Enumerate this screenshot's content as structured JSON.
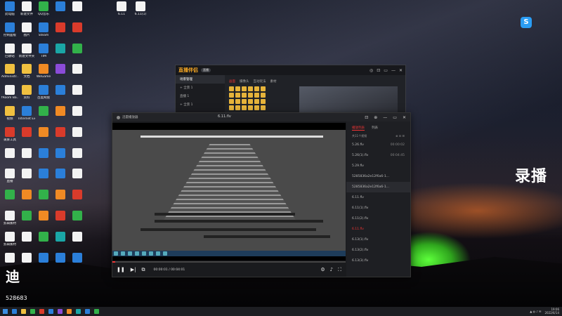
{
  "desktop": {
    "icons": [
      {
        "label": "此电脑",
        "col": 0,
        "row": 0,
        "kind": "app-blue"
      },
      {
        "label": "控制面板",
        "col": 0,
        "row": 1,
        "kind": "app-blue"
      },
      {
        "label": "回收站",
        "col": 0,
        "row": 2,
        "kind": "file"
      },
      {
        "label": "Administr...",
        "col": 0,
        "row": 3,
        "kind": "folder"
      },
      {
        "label": "fRoom Ba...",
        "col": 0,
        "row": 4,
        "kind": "file"
      },
      {
        "label": "视频",
        "col": 0,
        "row": 5,
        "kind": "folder"
      },
      {
        "label": "录屏工具",
        "col": 0,
        "row": 6,
        "kind": "app-red"
      },
      {
        "label": "",
        "col": 0,
        "row": 7,
        "kind": "file"
      },
      {
        "label": "直播",
        "col": 0,
        "row": 8,
        "kind": "file"
      },
      {
        "label": "",
        "col": 0,
        "row": 9,
        "kind": "app-green"
      },
      {
        "label": "剪辑素材",
        "col": 0,
        "row": 10,
        "kind": "file"
      },
      {
        "label": "剪辑素材",
        "col": 0,
        "row": 11,
        "kind": "file"
      },
      {
        "label": "",
        "col": 0,
        "row": 12,
        "kind": "file"
      },
      {
        "label": "新建文件",
        "col": 1,
        "row": 0,
        "kind": "file"
      },
      {
        "label": "图片",
        "col": 1,
        "row": 1,
        "kind": "file"
      },
      {
        "label": "新建文件夹",
        "col": 1,
        "row": 2,
        "kind": "file"
      },
      {
        "label": "文档",
        "col": 1,
        "row": 3,
        "kind": "folder"
      },
      {
        "label": "资料",
        "col": 1,
        "row": 4,
        "kind": "folder"
      },
      {
        "label": "Internet Explorer",
        "col": 1,
        "row": 5,
        "kind": "app-blue"
      },
      {
        "label": "",
        "col": 1,
        "row": 6,
        "kind": "app-red"
      },
      {
        "label": "",
        "col": 1,
        "row": 7,
        "kind": "file"
      },
      {
        "label": "",
        "col": 1,
        "row": 8,
        "kind": "file"
      },
      {
        "label": "",
        "col": 1,
        "row": 9,
        "kind": "app-orange"
      },
      {
        "label": "",
        "col": 1,
        "row": 10,
        "kind": "app-green"
      },
      {
        "label": "",
        "col": 1,
        "row": 11,
        "kind": "file"
      },
      {
        "label": "",
        "col": 1,
        "row": 12,
        "kind": "file"
      },
      {
        "label": "QQ音乐",
        "col": 2,
        "row": 0,
        "kind": "app-green"
      },
      {
        "label": "Steam",
        "col": 2,
        "row": 1,
        "kind": "app-blue"
      },
      {
        "label": "TIM",
        "col": 2,
        "row": 2,
        "kind": "app-blue"
      },
      {
        "label": "WeGame",
        "col": 2,
        "row": 3,
        "kind": "app-orange"
      },
      {
        "label": "百度网盘",
        "col": 2,
        "row": 4,
        "kind": "app-blue"
      },
      {
        "label": "",
        "col": 2,
        "row": 5,
        "kind": "app-green"
      },
      {
        "label": "",
        "col": 2,
        "row": 6,
        "kind": "app-orange"
      },
      {
        "label": "",
        "col": 2,
        "row": 7,
        "kind": "app-blue"
      },
      {
        "label": "",
        "col": 2,
        "row": 8,
        "kind": "app-blue"
      },
      {
        "label": "",
        "col": 2,
        "row": 9,
        "kind": "app-green"
      },
      {
        "label": "",
        "col": 2,
        "row": 10,
        "kind": "app-orange"
      },
      {
        "label": "",
        "col": 2,
        "row": 11,
        "kind": "app-green"
      },
      {
        "label": "",
        "col": 2,
        "row": 12,
        "kind": "app-blue"
      },
      {
        "label": "",
        "col": 3,
        "row": 0,
        "kind": "app-blue"
      },
      {
        "label": "",
        "col": 3,
        "row": 1,
        "kind": "app-red"
      },
      {
        "label": "",
        "col": 3,
        "row": 2,
        "kind": "app-teal"
      },
      {
        "label": "",
        "col": 3,
        "row": 3,
        "kind": "app-purple"
      },
      {
        "label": "",
        "col": 3,
        "row": 4,
        "kind": "app-blue"
      },
      {
        "label": "",
        "col": 3,
        "row": 5,
        "kind": "app-orange"
      },
      {
        "label": "",
        "col": 3,
        "row": 6,
        "kind": "app-red"
      },
      {
        "label": "",
        "col": 3,
        "row": 7,
        "kind": "app-blue"
      },
      {
        "label": "",
        "col": 3,
        "row": 8,
        "kind": "app-blue"
      },
      {
        "label": "",
        "col": 3,
        "row": 9,
        "kind": "app-orange"
      },
      {
        "label": "",
        "col": 3,
        "row": 10,
        "kind": "app-red"
      },
      {
        "label": "",
        "col": 3,
        "row": 11,
        "kind": "app-teal"
      },
      {
        "label": "",
        "col": 3,
        "row": 12,
        "kind": "app-blue"
      },
      {
        "label": "",
        "col": 4,
        "row": 0,
        "kind": "file"
      },
      {
        "label": "",
        "col": 4,
        "row": 1,
        "kind": "app-red"
      },
      {
        "label": "",
        "col": 4,
        "row": 2,
        "kind": "app-green"
      },
      {
        "label": "",
        "col": 4,
        "row": 3,
        "kind": "file"
      },
      {
        "label": "",
        "col": 4,
        "row": 4,
        "kind": "file"
      },
      {
        "label": "",
        "col": 4,
        "row": 5,
        "kind": "file"
      },
      {
        "label": "",
        "col": 4,
        "row": 6,
        "kind": "file"
      },
      {
        "label": "",
        "col": 4,
        "row": 7,
        "kind": "file"
      },
      {
        "label": "",
        "col": 4,
        "row": 8,
        "kind": "file"
      },
      {
        "label": "",
        "col": 4,
        "row": 9,
        "kind": "app-red"
      },
      {
        "label": "",
        "col": 4,
        "row": 10,
        "kind": "app-green"
      },
      {
        "label": "",
        "col": 4,
        "row": 11,
        "kind": "file"
      },
      {
        "label": "",
        "col": 4,
        "row": 12,
        "kind": "app-blue"
      },
      {
        "label": "6.11",
        "col": "x170",
        "row": 0,
        "kind": "file"
      },
      {
        "label": "6.11(1)",
        "col": "x197",
        "row": 0,
        "kind": "file"
      }
    ],
    "side_text": "录播",
    "corner_logo": "S",
    "cam_id_glyph": "迪",
    "cam_id_number": "528683"
  },
  "bg_window": {
    "brand": "直播伴侣",
    "badge": "直播",
    "controls": [
      "◎",
      "⊡",
      "▭",
      "—",
      "✕"
    ],
    "sidebar": [
      "场景管理",
      "+ 全景 1",
      "直播 1",
      "+ 全景 1"
    ],
    "tabs": [
      "画面",
      "摄像头",
      "互动玩法",
      "素材"
    ]
  },
  "player": {
    "logo": "迅雷播放器",
    "file_title": "6.11.flv",
    "title_controls": [
      "⊡",
      "⊕",
      "—",
      "▭",
      "✕"
    ],
    "time": "00:00:01 / 00:04:01",
    "progress": 0.01,
    "playlist": {
      "tabs": [
        "播放列表",
        "列表"
      ],
      "header": "共11个视频",
      "items": [
        {
          "name": "5.26.flv",
          "dur": "00:00:02"
        },
        {
          "name": "5.26(1).flv",
          "dur": "00:04:45"
        },
        {
          "name": "5.29.flv",
          "dur": ""
        },
        {
          "name": "5285836a2e12f6a6-1...",
          "dur": ""
        },
        {
          "name": "5285836a2e12f6a6-1...",
          "dur": ""
        },
        {
          "name": "6.11.flv",
          "dur": ""
        },
        {
          "name": "6.11(1).flv",
          "dur": ""
        },
        {
          "name": "6.11(2).flv",
          "dur": ""
        },
        {
          "name": "6.11.flv",
          "dur": "",
          "current": true
        },
        {
          "name": "6.13(1).flv",
          "dur": ""
        },
        {
          "name": "6.13(2).flv",
          "dur": ""
        },
        {
          "name": "6.13(3).flv",
          "dur": ""
        }
      ]
    }
  },
  "taskbar": {
    "time": "19:06",
    "date": "2022/6/14",
    "apps": [
      "#2b7fd9",
      "#f0c040",
      "#32b14a",
      "#d93b2b",
      "#2b7fd9",
      "#8a4bd8",
      "#f08a24",
      "#1aa6a6",
      "#2b7fd9",
      "#32b14a"
    ]
  }
}
